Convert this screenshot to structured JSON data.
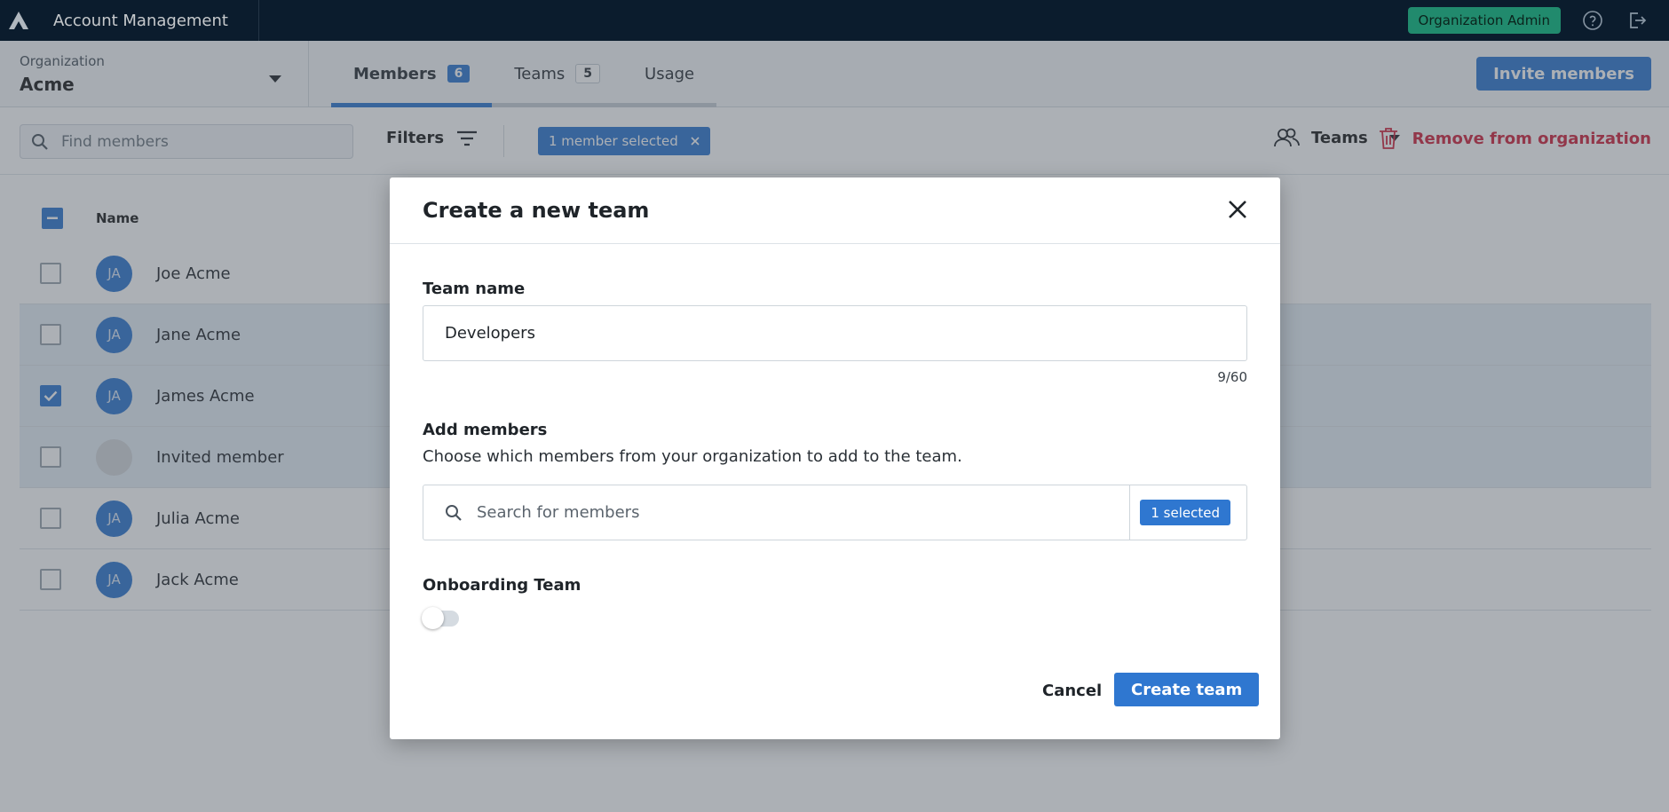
{
  "app": {
    "title": "Account Management",
    "role_badge": "Organization Admin"
  },
  "organization": {
    "label": "Organization",
    "name": "Acme"
  },
  "tabs": [
    {
      "label": "Members",
      "count": "6"
    },
    {
      "label": "Teams",
      "count": "5"
    },
    {
      "label": "Usage"
    }
  ],
  "invite_label": "Invite members",
  "toolbar": {
    "search_placeholder": "Find members",
    "filters_label": "Filters",
    "selection_chip": "1 member selected",
    "teams_dropdown": "Teams",
    "remove_label": "Remove from organization"
  },
  "table": {
    "header_name": "Name",
    "rows": [
      {
        "initials": "JA",
        "name": "Joe Acme",
        "checked": false
      },
      {
        "initials": "JA",
        "name": "Jane Acme",
        "checked": false
      },
      {
        "initials": "JA",
        "name": "James Acme",
        "checked": true
      },
      {
        "initials": "",
        "name": "Invited member",
        "checked": false
      },
      {
        "initials": "JA",
        "name": "Julia Acme",
        "checked": false
      },
      {
        "initials": "JA",
        "name": "Jack Acme",
        "checked": false
      }
    ]
  },
  "modal": {
    "title": "Create a new team",
    "team_name_label": "Team name",
    "team_name_value": "Developers",
    "char_count": "9/60",
    "add_members_label": "Add members",
    "add_members_helper": "Choose which members from your organization to add to the team.",
    "member_search_placeholder": "Search for members",
    "selected_badge": "1 selected",
    "onboarding_label": "Onboarding Team",
    "onboarding_enabled": false,
    "cancel_label": "Cancel",
    "create_label": "Create team"
  },
  "colors": {
    "accent": "#2f77d0",
    "topbar": "#0e2235",
    "danger": "#d0243c",
    "admin_badge": "#27a380"
  }
}
